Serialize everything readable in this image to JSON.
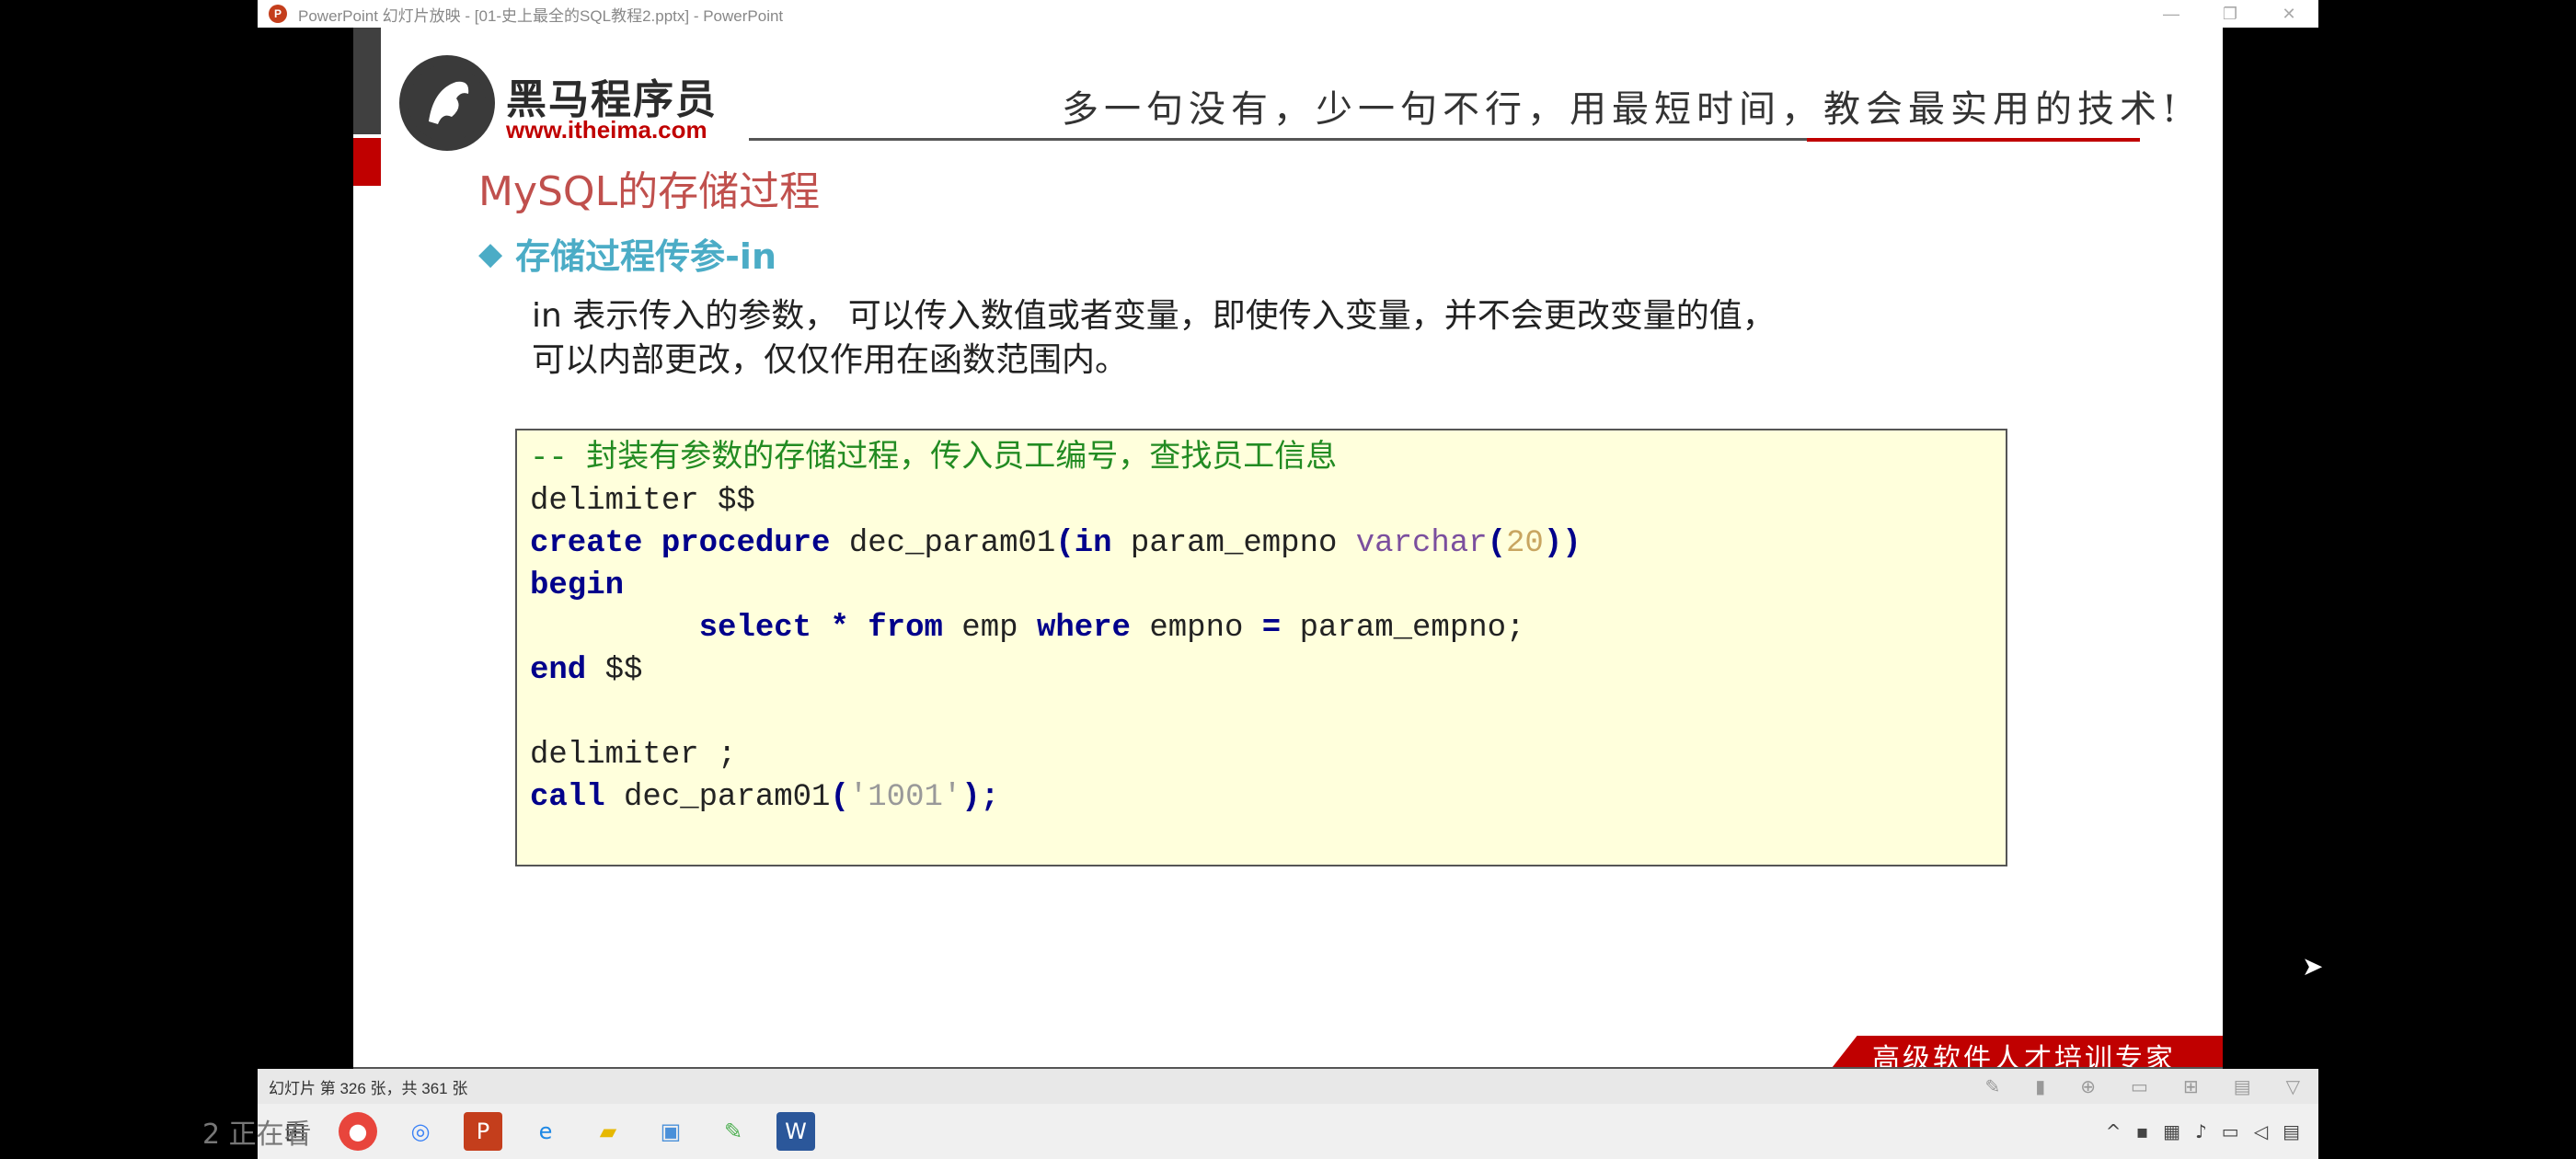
{
  "window": {
    "title": "PowerPoint 幻灯片放映 - [01-史上最全的SQL教程2.pptx] - PowerPoint",
    "minimize": "—",
    "restore": "❐",
    "close": "✕"
  },
  "slide": {
    "logo_text": "黑马程序员",
    "logo_url": "www.itheima.com",
    "slogan": "多一句没有，少一句不行，用最短时间，教会最实用的技术!",
    "title": "MySQL的存储过程",
    "subtitle": "存储过程传参-in",
    "desc_line1": "in 表示传入的参数， 可以传入数值或者变量，即使传入变量，并不会更改变量的值，",
    "desc_line2": "可以内部更改，仅仅作用在函数范围内。",
    "banner": "高级软件人才培训专家"
  },
  "code": {
    "l1_comment": "-- 封装有参数的存储过程，传入员工编号，查找员工信息",
    "l2": "delimiter $$",
    "l3_kw1": "create",
    "l3_kw2": "procedure",
    "l3_name": " dec_param01",
    "l3_paren_open": "(",
    "l3_in": "in",
    "l3_param": " param_empno ",
    "l3_type": "varchar",
    "l3_p2": "(",
    "l3_num": "20",
    "l3_close": "))",
    "l4": "begin",
    "l5_indent": "         ",
    "l5_select": "select",
    "l5_star": " * ",
    "l5_from": "from",
    "l5_emp": " emp ",
    "l5_where": "where",
    "l5_rest1": " empno ",
    "l5_eq": "=",
    "l5_rest2": " param_empno;",
    "l6_end": "end",
    "l6_rest": " $$",
    "l8": "delimiter ;",
    "l9_call": "call",
    "l9_name": " dec_param01",
    "l9_po": "(",
    "l9_str": "'1001'",
    "l9_pc": ");"
  },
  "statusbar": {
    "slide_info": "幻灯片 第 326 张，共 361 张"
  },
  "taskbar": {
    "icons": [
      "windows-start",
      "chrome",
      "browser",
      "powerpoint",
      "edge",
      "file-explorer",
      "remote-desktop",
      "paint",
      "word"
    ]
  },
  "overlay": {
    "watermark": "2 正在看"
  }
}
